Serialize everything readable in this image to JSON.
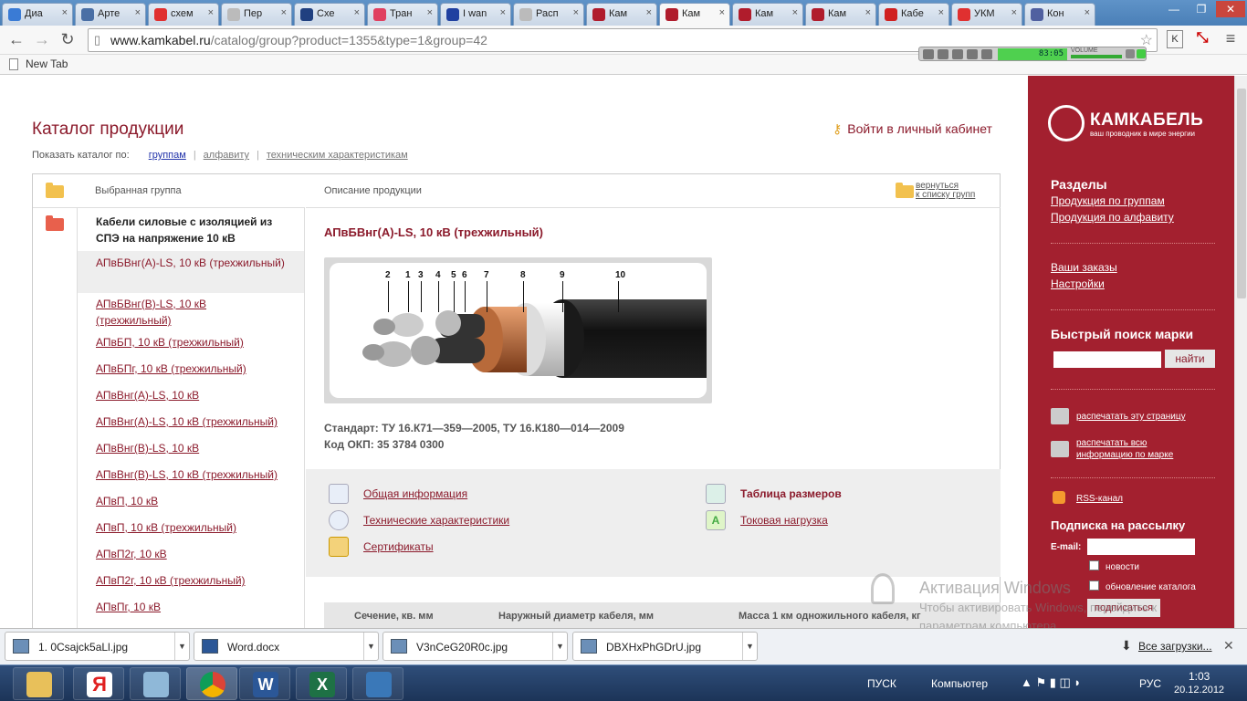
{
  "browser": {
    "tabs": [
      {
        "label": "Диа",
        "color": "#3a7bd5"
      },
      {
        "label": "Арте",
        "color": "#4a6fa5"
      },
      {
        "label": "схем",
        "color": "#e03030"
      },
      {
        "label": "Пер",
        "color": "#bbbbbb"
      },
      {
        "label": "Схе",
        "color": "#204080"
      },
      {
        "label": "Тран",
        "color": "#e04060"
      },
      {
        "label": "I wan",
        "color": "#2040a0"
      },
      {
        "label": "Расп",
        "color": "#bbbbbb"
      },
      {
        "label": "Кам",
        "color": "#b01c2c"
      },
      {
        "label": "Кам",
        "color": "#b01c2c"
      },
      {
        "label": "Кам",
        "color": "#b01c2c"
      },
      {
        "label": "Кам",
        "color": "#b01c2c"
      },
      {
        "label": "Кабе",
        "color": "#d02020"
      },
      {
        "label": "УКМ",
        "color": "#e03030"
      },
      {
        "label": "Кон",
        "color": "#5060a0"
      }
    ],
    "active_tab_index": 9,
    "url_host": "www.kamkabel.ru",
    "url_path": "/catalog/group?product=1355&type=1&group=42",
    "bookmark": "New Tab",
    "player_time": "83:05",
    "player_volume_label": "VOLUME"
  },
  "page": {
    "catalog_title": "Каталог продукции",
    "login_link": "Войти в личный кабинет",
    "show_by_label": "Показать каталог по:",
    "show_by_links": [
      "группам",
      "алфавиту",
      "техническим характеристикам"
    ],
    "left_header": "Выбранная группа",
    "right_header": "Описание продукции",
    "back_link_line1": "вернуться",
    "back_link_line2": "к списку групп",
    "group_title": "Кабели силовые с изоляцией из СПЭ на напряжение 10 кВ",
    "current_item": "АПвБВнг(А)-LS, 10 кВ (трехжильный)",
    "items": [
      "АПвБВнг(В)-LS, 10 кВ (трехжильный)",
      "АПвБП, 10 кВ (трехжильный)",
      "АПвБПг, 10 кВ (трехжильный)",
      "АПвВнг(А)-LS, 10 кВ",
      "АПвВнг(А)-LS, 10 кВ (трехжильный)",
      "АПвВнг(В)-LS, 10 кВ",
      "АПвВнг(В)-LS, 10 кВ (трехжильный)",
      "АПвП, 10 кВ",
      "АПвП, 10 кВ (трехжильный)",
      "АПвП2г, 10 кВ",
      "АПвП2г, 10 кВ (трехжильный)",
      "АПвПг, 10 кВ"
    ],
    "product_title": "АПвБВнг(А)-LS, 10 кВ (трехжильный)",
    "cable_labels": [
      "2",
      "1",
      "3",
      "4",
      "5",
      "6",
      "7",
      "8",
      "9",
      "10"
    ],
    "standard": "Стандарт: ТУ 16.К71—359—2005, ТУ 16.К180—014—2009",
    "okp": "Код ОКП: 35 3784 0300",
    "links": {
      "general": "Общая информация",
      "technical": "Технические характеристики",
      "certificates": "Сертификаты",
      "sizes": "Таблица размеров",
      "current_load": "Токовая нагрузка"
    },
    "table_headers": [
      "Сечение, кв. мм",
      "Наружный диаметр кабеля, мм",
      "Масса 1 км одножильного кабеля, кг"
    ]
  },
  "sidebar": {
    "brand": "КАМКАБЕЛЬ",
    "tagline": "ваш проводник в мире энергии",
    "sections_title": "Разделы",
    "section_links": [
      "Продукция по группам",
      "Продукция по алфавиту"
    ],
    "account_links": [
      "Ваши заказы",
      "Настройки"
    ],
    "quick_search_title": "Быстрый поиск марки",
    "search_button": "найти",
    "print_page": "распечатать эту страницу",
    "print_all_line1": "распечатать всю",
    "print_all_line2": "информацию по марке",
    "rss": "RSS-канал",
    "subscribe_title": "Подписка на рассылку",
    "email_label": "E-mail:",
    "opt_news": "новости",
    "opt_catalog": "обновление каталога",
    "subscribe_button": "подписаться"
  },
  "watermark": {
    "title": "Активация Windows",
    "line1": "Чтобы активировать Windows, перейдите к",
    "line2": "параметрам компьютера."
  },
  "downloads": {
    "files": [
      "1. 0Csajck5aLl.jpg",
      "Word.docx",
      "V3nCeG20R0c.jpg",
      "DBXHxPhGDrU.jpg"
    ],
    "all_downloads": "Все загрузки..."
  },
  "taskbar": {
    "start_label": "ПУСК",
    "computer_label": "Компьютер",
    "lang": "РУС",
    "time": "1:03",
    "date": "20.12.2012"
  }
}
